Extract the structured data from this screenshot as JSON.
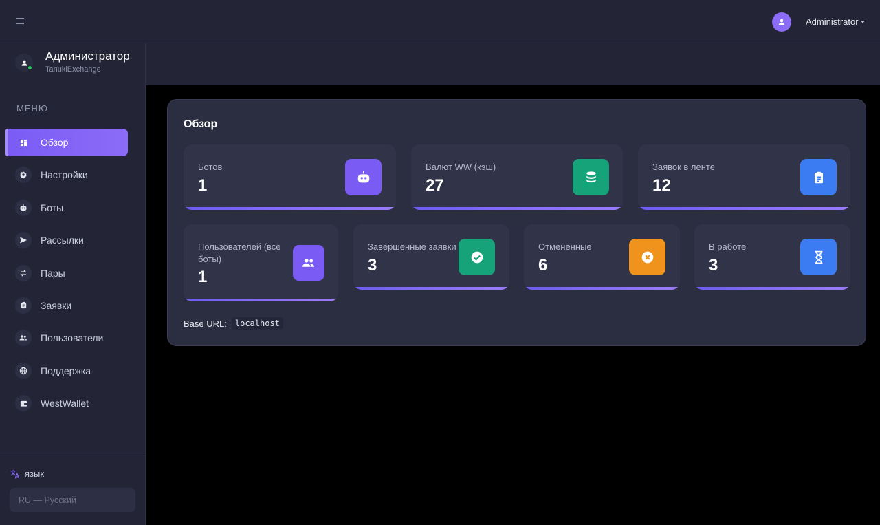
{
  "header": {
    "user_name": "Administrator"
  },
  "sidebar": {
    "profile_name": "Администратор",
    "profile_sub": "TanukiExchange",
    "menu_title": "МЕНЮ",
    "items": [
      {
        "label": "Обзор",
        "icon": "dashboard-icon",
        "active": true
      },
      {
        "label": "Настройки",
        "icon": "gear-icon"
      },
      {
        "label": "Боты",
        "icon": "robot-icon"
      },
      {
        "label": "Рассылки",
        "icon": "send-icon"
      },
      {
        "label": "Пары",
        "icon": "swap-icon"
      },
      {
        "label": "Заявки",
        "icon": "clipboard-icon"
      },
      {
        "label": "Пользователи",
        "icon": "users-icon"
      },
      {
        "label": "Поддержка",
        "icon": "globe-icon"
      },
      {
        "label": "WestWallet",
        "icon": "wallet-icon"
      }
    ],
    "lang_title": "язык",
    "lang_value": "RU — Русский"
  },
  "overview": {
    "title": "Обзор",
    "stats": [
      {
        "label": "Ботов",
        "value": "1",
        "icon": "robot-icon",
        "color": "#7a5cf5"
      },
      {
        "label": "Валют WW (кэш)",
        "value": "27",
        "icon": "database-icon",
        "color": "#16a37a"
      },
      {
        "label": "Заявок в ленте",
        "value": "12",
        "icon": "clipboard-icon",
        "color": "#3b7cf2"
      },
      {
        "label": "Пользователей (все боты)",
        "value": "1",
        "icon": "users-icon",
        "color": "#7a5cf5"
      },
      {
        "label": "Завершённые заявки",
        "value": "3",
        "icon": "check-circle-icon",
        "color": "#16a37a"
      },
      {
        "label": "Отменённые",
        "value": "6",
        "icon": "x-circle-icon",
        "color": "#f0931c"
      },
      {
        "label": "В работе",
        "value": "3",
        "icon": "hourglass-icon",
        "color": "#3b7cf2"
      }
    ],
    "base_url_label": "Base URL:",
    "base_url_value": "localhost"
  }
}
